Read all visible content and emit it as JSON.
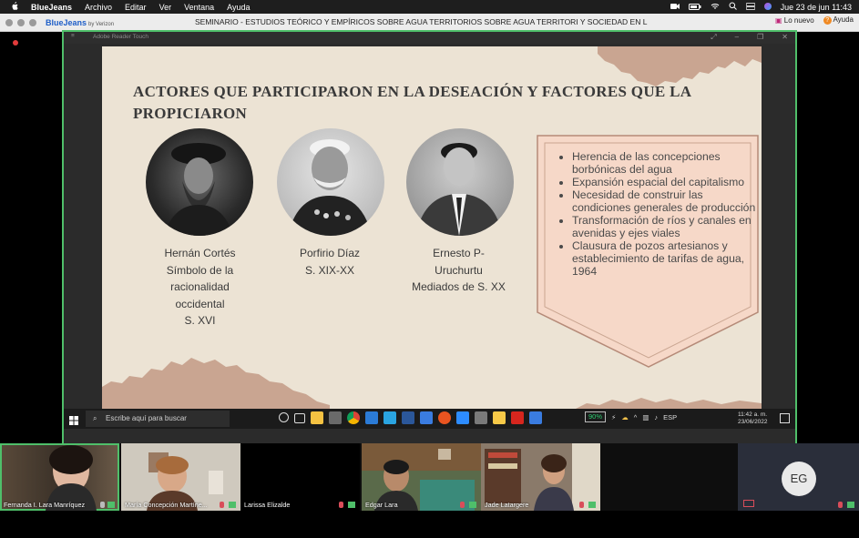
{
  "menubar": {
    "app": "BlueJeans",
    "items": [
      "Archivo",
      "Editar",
      "Ver",
      "Ventana",
      "Ayuda"
    ],
    "clock": "Jue 23 de jun  11:43"
  },
  "titlebar": {
    "logo": "BlueJeans",
    "logo_sub": "by Verizon",
    "meeting_title": "SEMINARIO - ESTUDIOS TEÓRICO Y EMPÍRICOS SOBRE AGUA TERRITORIOS SOBRE AGUA TERRITORI Y SOCIEDAD EN L",
    "whats_new": "Lo nuevo",
    "help": "Ayuda"
  },
  "shared_window": {
    "app_title": "Adobe Reader Touch"
  },
  "slide": {
    "title": "ACTORES QUE PARTICIPARON EN LA DESEACIÓN Y FACTORES QUE LA PROPICIARON",
    "actors": [
      {
        "lines": [
          "Hernán Cortés",
          "Símbolo de la",
          "racionalidad",
          "occidental",
          "S. XVI"
        ]
      },
      {
        "lines": [
          "Porfirio Díaz",
          "S. XIX-XX"
        ]
      },
      {
        "lines": [
          "Ernesto P-",
          "Uruchurtu",
          "Mediados de S. XX"
        ]
      }
    ],
    "factors": [
      "Herencia de las concepciones borbónicas del agua",
      "Expansión espacial del capitalismo",
      "Necesidad de construir las condiciones generales de producción",
      "Transformación de ríos y canales en avenidas y ejes viales",
      "Clausura de pozos artesianos y establecimiento de tarifas de agua, 1964"
    ],
    "colors": {
      "background": "#ece3d4",
      "accent": "#c9a591",
      "panel": "#f6d8c8"
    }
  },
  "taskbar": {
    "search_placeholder": "Escribe aquí para buscar",
    "battery": "90%",
    "language": "ESP",
    "time": "11:42 a. m.",
    "date": "23/06/2022"
  },
  "participants": [
    {
      "name": "Fernanda I. Lara Manríquez",
      "active": true
    },
    {
      "name": "María Concepción Martíne..."
    },
    {
      "name": "Larissa Elizalde"
    },
    {
      "name": "Edgar Lara"
    },
    {
      "name": "Jade Latargere"
    },
    {
      "name": "",
      "initials": "EG"
    }
  ]
}
